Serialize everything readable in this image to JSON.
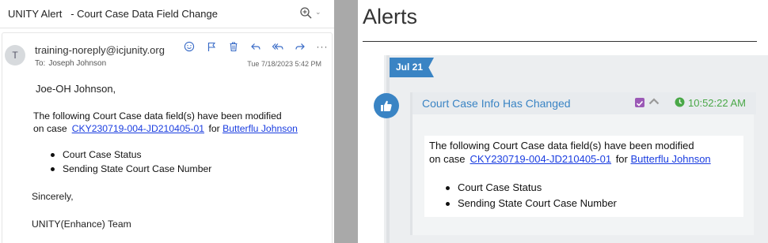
{
  "email": {
    "subject": "UNITY Alert   - Court Case Data Field Change",
    "sender_initial": "T",
    "sender": "training-noreply@icjunity.org",
    "to_label": "To:",
    "to_value": "Joseph Johnson",
    "date": "Tue 7/18/2023 5:42 PM",
    "actions": [
      "smiley-icon",
      "flag-icon",
      "trash-icon",
      "reply-icon",
      "reply-all-icon",
      "forward-icon",
      "more-icon"
    ],
    "greeting": "Joe-OH Johnson,",
    "body_line1": "The following Court Case data field(s) have been modified",
    "body_on_case": "on case",
    "case_link": "CKY230719-004-JD210405-01",
    "for_text": "for",
    "person_link": "Butterflu Johnson",
    "fields": [
      "Court Case Status",
      "Sending State Court Case Number"
    ],
    "sincerely": "Sincerely,",
    "team": "UNITY(Enhance) Team"
  },
  "alerts": {
    "title": "Alerts",
    "date_tag": "Jul 21",
    "item": {
      "title": "Court Case Info Has Changed",
      "time": "10:52:22 AM",
      "body_line1": "The following Court Case data field(s) have been modified",
      "body_on_case": "on case",
      "case_link": "CKY230719-004-JD210405-01",
      "for_text": "for",
      "person_link": "Butterflu Johnson",
      "fields": [
        "Court Case Status",
        "Sending State Court Case Number"
      ]
    }
  },
  "colors": {
    "accent_blue": "#3a84c4",
    "link_blue": "#1a3de0",
    "time_green": "#4aa848",
    "checkbox_purple": "#9b59b6"
  }
}
